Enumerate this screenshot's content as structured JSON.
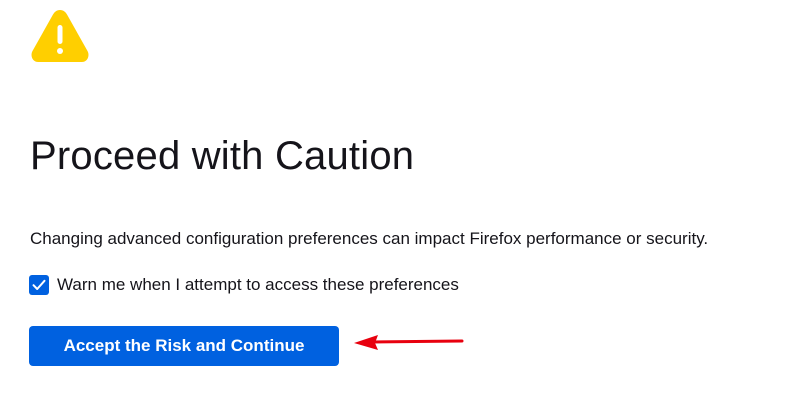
{
  "warning": {
    "icon": "warning-icon",
    "color": "#ffcf00"
  },
  "title": "Proceed with Caution",
  "description": "Changing advanced configuration preferences can impact Firefox performance or security.",
  "warn_checkbox": {
    "label": "Warn me when I attempt to access these preferences",
    "checked": true
  },
  "accept_button": {
    "label": "Accept the Risk and Continue",
    "color": "#0061e0"
  },
  "annotation": {
    "icon": "red-arrow-icon",
    "color": "#e8000e"
  }
}
